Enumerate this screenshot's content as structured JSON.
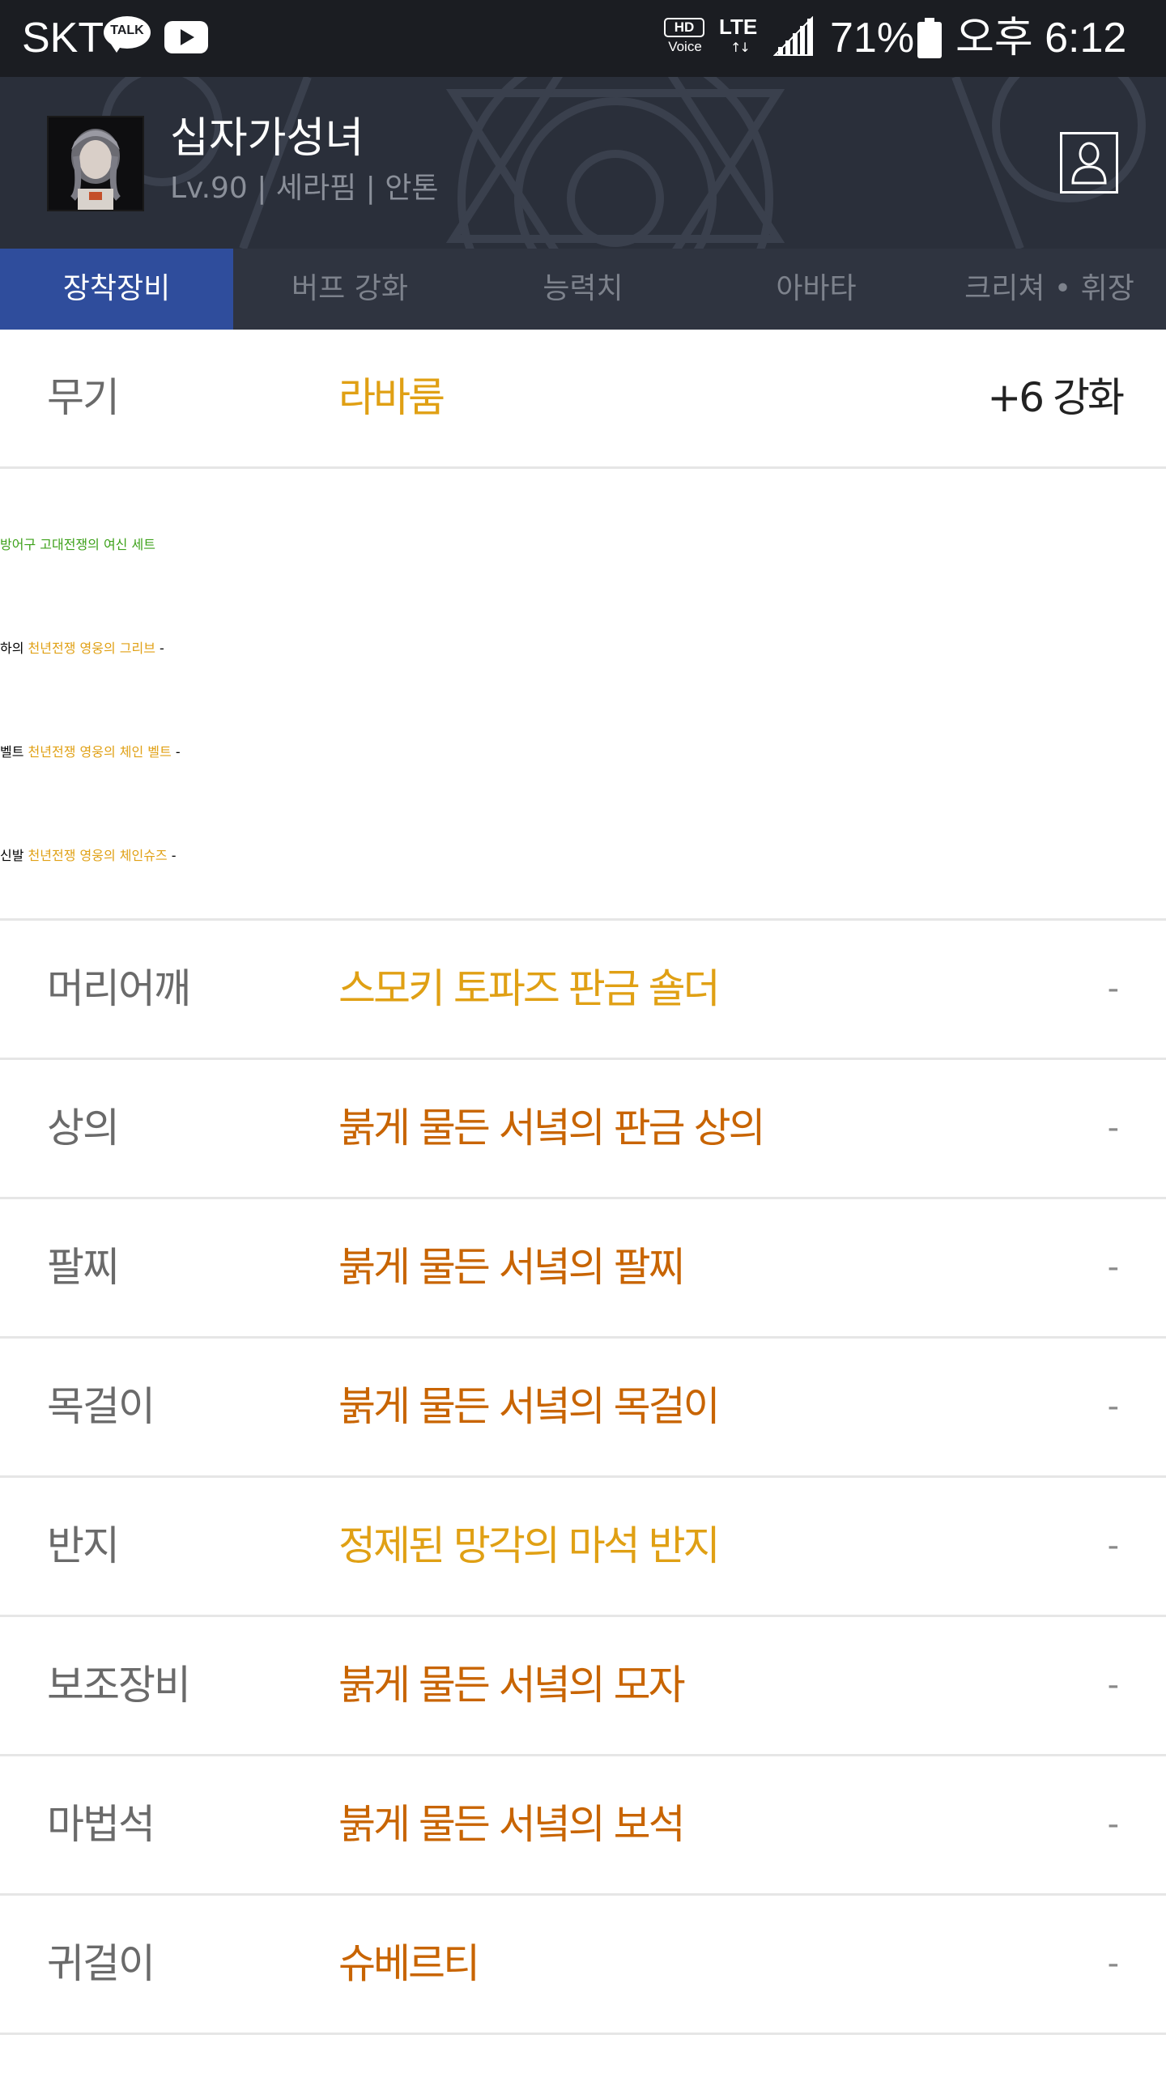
{
  "status_bar": {
    "carrier": "SKT",
    "talk_badge": "TALK",
    "hd_label": "HD",
    "voice_label": "Voice",
    "network": "LTE",
    "network_arrows": "↑↓",
    "battery_percent": "71%",
    "time": "오후 6:12",
    "icons": [
      "kakaotalk-icon",
      "youtube-icon",
      "hd-voice-icon",
      "lte-icon",
      "signal-icon",
      "battery-icon"
    ]
  },
  "profile": {
    "name": "십자가성녀",
    "info": "Lv.90 | 세라핌 | 안톤",
    "avatar_icon": "character-portrait",
    "profile_button_icon": "person-icon"
  },
  "tabs": [
    {
      "label": "장착장비",
      "active": true
    },
    {
      "label": "버프 강화",
      "active": false
    },
    {
      "label": "능력치",
      "active": false
    },
    {
      "label": "아바타",
      "active": false
    },
    {
      "label": "크리쳐 • 휘장",
      "active": false
    }
  ],
  "colors": {
    "unique": "#e0a014",
    "epic": "#c86400",
    "set": "#3da11a",
    "active_tab": "#2f4d9c"
  },
  "equipment": {
    "weapon": {
      "slot": "무기",
      "name": "라바룸",
      "extra": "+6 강화"
    },
    "armor": {
      "slot": "방어구",
      "set_name": "고대전쟁의 여신 세트",
      "items": [
        {
          "slot": "하의",
          "name": "천년전쟁 영웅의 그리브",
          "extra": "-"
        },
        {
          "slot": "벨트",
          "name": "천년전쟁 영웅의 체인 벨트",
          "extra": "-"
        },
        {
          "slot": "신발",
          "name": "천년전쟁 영웅의 체인슈즈",
          "extra": "-"
        }
      ]
    },
    "rows": [
      {
        "slot": "머리어깨",
        "name": "스모키 토파즈 판금 숄더",
        "extra": "-"
      },
      {
        "slot": "상의",
        "name": "붉게 물든 서녘의 판금 상의",
        "extra": "-"
      },
      {
        "slot": "팔찌",
        "name": "붉게 물든 서녘의 팔찌",
        "extra": "-"
      },
      {
        "slot": "목걸이",
        "name": "붉게 물든 서녘의 목걸이",
        "extra": "-"
      },
      {
        "slot": "반지",
        "name": "정제된 망각의 마석 반지",
        "extra": "-"
      },
      {
        "slot": "보조장비",
        "name": "붉게 물든 서녘의 모자",
        "extra": "-"
      },
      {
        "slot": "마법석",
        "name": "붉게 물든 서녘의 보석",
        "extra": "-"
      },
      {
        "slot": "귀걸이",
        "name": "슈베르티",
        "extra": "-"
      }
    ]
  }
}
